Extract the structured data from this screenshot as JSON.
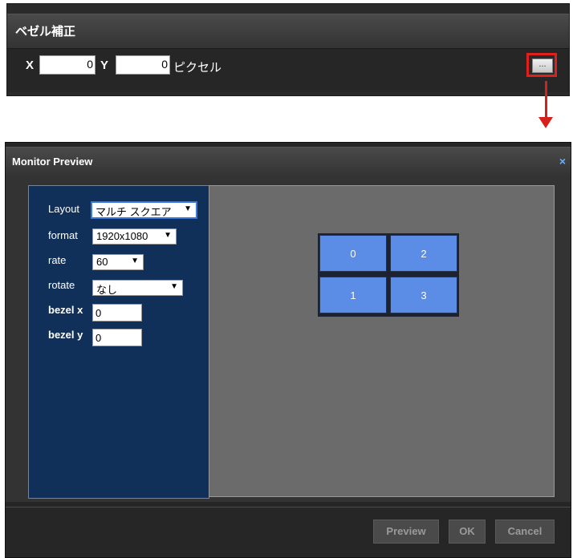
{
  "bezel": {
    "title": "ベゼル補正",
    "x_label": "X",
    "x_value": "0",
    "y_label": "Y",
    "y_value": "0",
    "unit": "ピクセル",
    "browse_label": "..."
  },
  "dialog": {
    "title": "Monitor Preview",
    "close": "×",
    "settings": {
      "layout_label": "Layout",
      "layout_value": "マルチ スクエア",
      "format_label": "format",
      "format_value": "1920x1080",
      "rate_label": "rate",
      "rate_value": "60",
      "rotate_label": "rotate",
      "rotate_value": "なし",
      "bezel_x_label": "bezel x",
      "bezel_x_value": "0",
      "bezel_y_label": "bezel y",
      "bezel_y_value": "0"
    },
    "monitors": [
      "0",
      "2",
      "1",
      "3"
    ],
    "buttons": {
      "preview": "Preview",
      "ok": "OK",
      "cancel": "Cancel"
    }
  },
  "colors": {
    "accent_red": "#e0201c",
    "monitor_blue": "#5c8de6",
    "settings_panel": "#10305a"
  }
}
